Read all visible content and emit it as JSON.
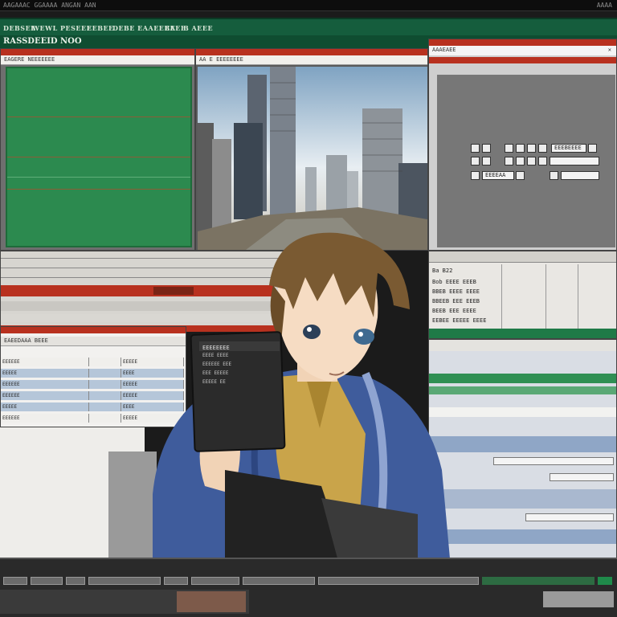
{
  "topbar": {
    "left_text": "AAGAAAC GGAAAA ANGAN AAN",
    "right_text": "AAAA"
  },
  "menubar": {
    "items": [
      "DEBSEE",
      "WEWL  PESEEE",
      "EEBEE",
      "DEBE  EAAEEBE",
      "EAEE",
      "B  AEEE"
    ]
  },
  "app": {
    "title": "RASSDEEID  NOO"
  },
  "panels": {
    "left_title": "EAGERE  NEEEEEEE",
    "city_title": "AA E EEEEEEEE",
    "settings_title": "AAAEAEE",
    "settings_button": "EEEBEEEE",
    "settings_field": "EEEEAA"
  },
  "mid_right_list": [
    "Ba  B22",
    "Bob  EEEE  EEEB",
    "BBEB  EEEE  EEEE",
    "BBEEB  EEE  EEEB",
    "BEEB  EEE  EEEE",
    "EEBEE  EEEEE  EEEE"
  ],
  "sheet": {
    "header": "EAEEDAAA    BEEE",
    "rows": [
      [
        "EEEEEE",
        "",
        "EEEEE"
      ],
      [
        "EEEEE",
        "",
        "EEEE"
      ],
      [
        "EEEEEE",
        "",
        "EEEEE"
      ],
      [
        "EEEEEE",
        "",
        "EEEEE"
      ],
      [
        "EEEEE",
        "",
        "EEEE"
      ],
      [
        "EEEEEE",
        "",
        "EEEEE"
      ]
    ]
  },
  "device": {
    "title": "EEEEEEEE",
    "lines": [
      "EEEE  EEEE",
      "EEEEEE  EEE",
      "EEE  EEEEE",
      "EEEEE  EE"
    ]
  },
  "colors": {
    "menubar_green": "#155d3d",
    "panel_red": "#b8311f",
    "grid_green": "#2c8a4f",
    "jacket_blue": "#3f5c9c",
    "shirt_yellow": "#c9a44a",
    "hair_brown": "#7a5a32"
  },
  "icons": {
    "search": "search-icon",
    "window_close": "close-icon"
  }
}
